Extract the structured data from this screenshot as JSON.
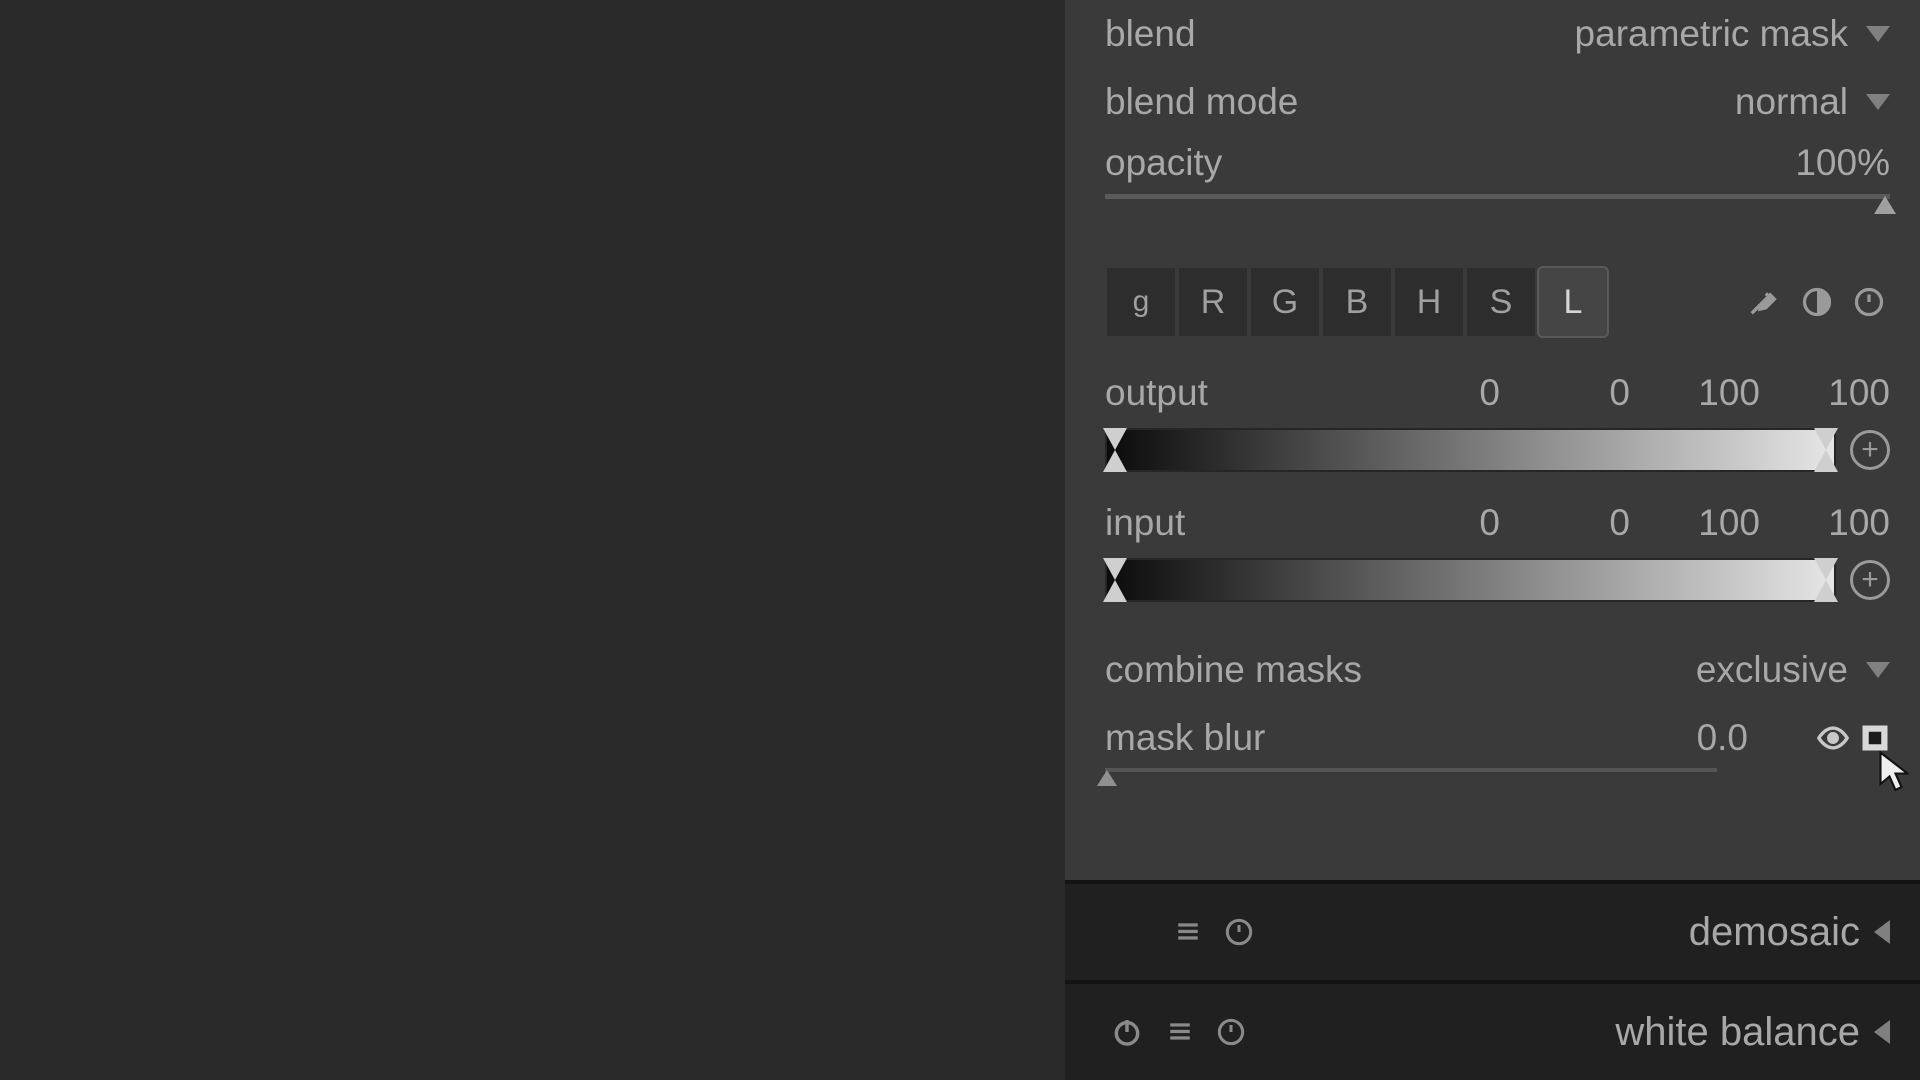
{
  "blend": {
    "label": "blend",
    "value": "parametric mask"
  },
  "blend_mode": {
    "label": "blend mode",
    "value": "normal"
  },
  "opacity": {
    "label": "opacity",
    "value": "100%",
    "percent": 100
  },
  "channels": [
    "g",
    "R",
    "G",
    "B",
    "H",
    "S",
    "L"
  ],
  "active_channel": "L",
  "output": {
    "label": "output",
    "vals": [
      "0",
      "0",
      "100",
      "100"
    ]
  },
  "input": {
    "label": "input",
    "vals": [
      "0",
      "0",
      "100",
      "100"
    ]
  },
  "combine": {
    "label": "combine masks",
    "value": "exclusive"
  },
  "mask_blur": {
    "label": "mask blur",
    "value": "0.0"
  },
  "modules": {
    "demosaic": "demosaic",
    "white_balance": "white balance"
  }
}
